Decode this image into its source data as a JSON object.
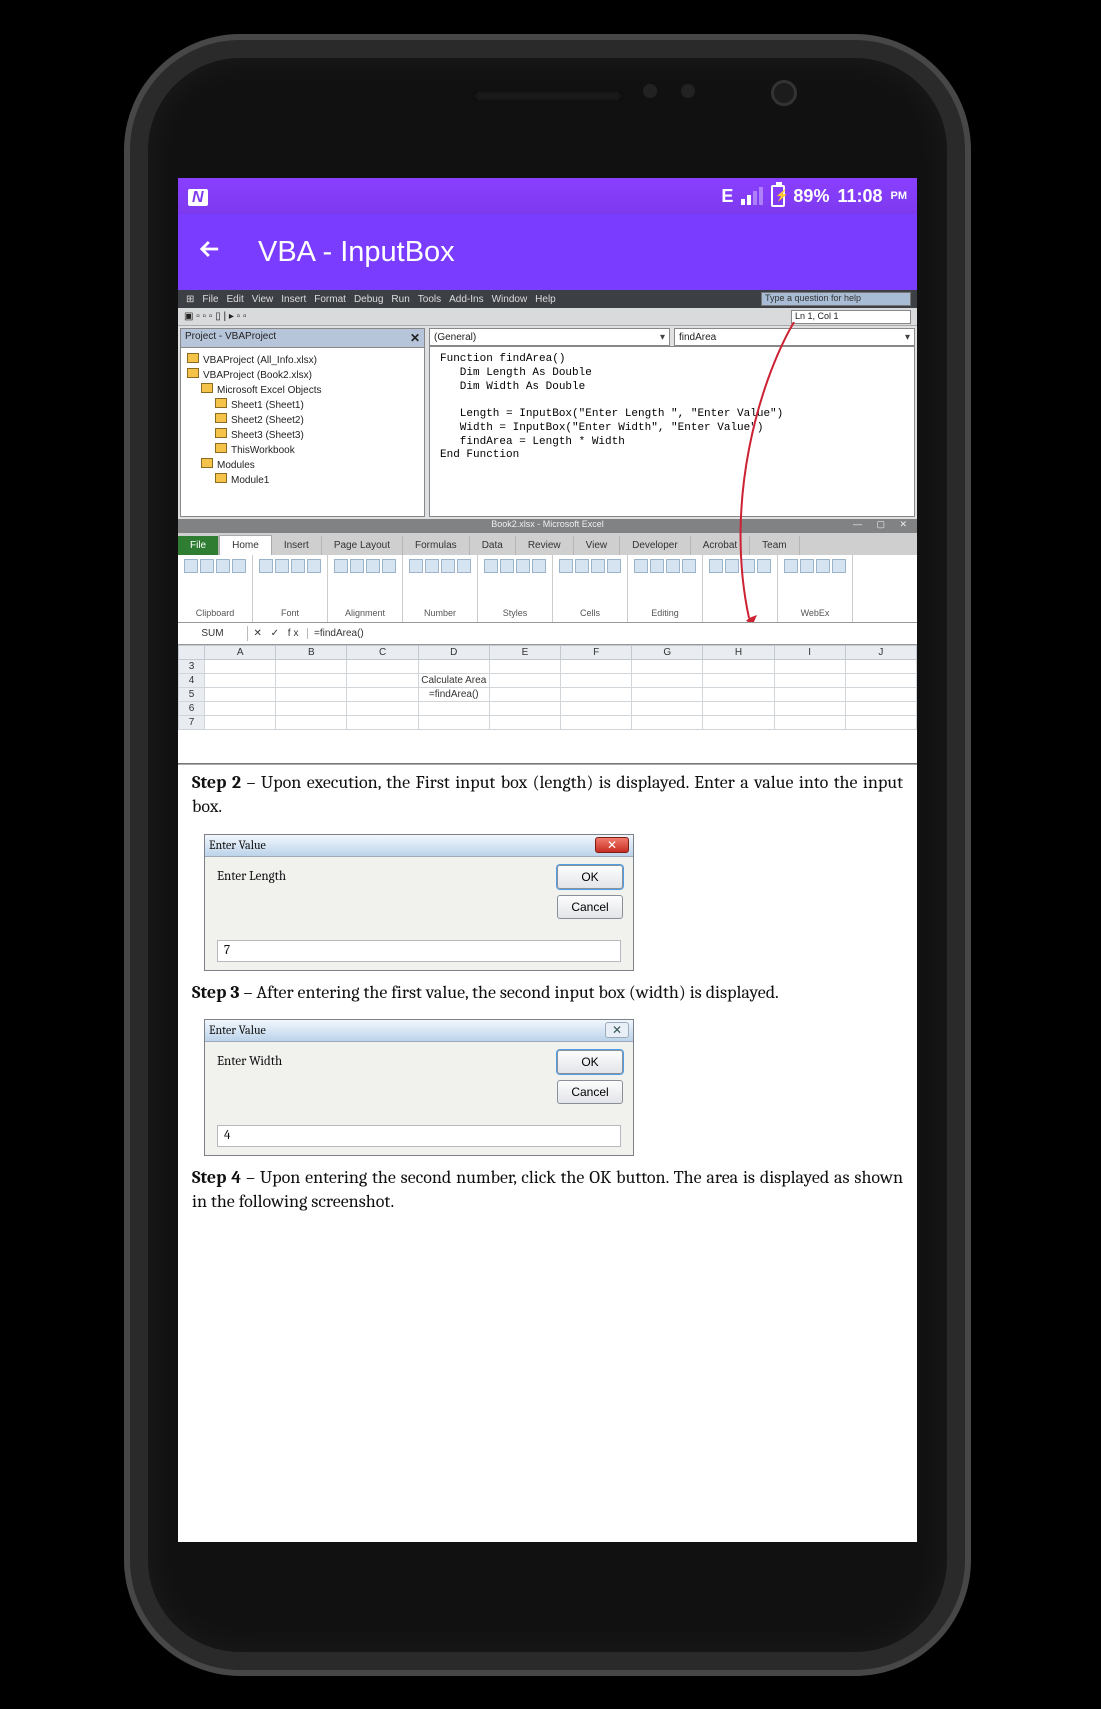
{
  "status_bar": {
    "n_icon": "N",
    "net_label": "E",
    "battery_pct": "89%",
    "time": "11:08",
    "time_suffix": "PM"
  },
  "app_bar": {
    "title": "VBA - InputBox"
  },
  "vba_editor": {
    "menus": [
      "File",
      "Edit",
      "View",
      "Insert",
      "Format",
      "Debug",
      "Run",
      "Tools",
      "Add-Ins",
      "Window",
      "Help"
    ],
    "help_placeholder": "Type a question for help",
    "line_col": "Ln 1, Col 1",
    "project_title": "Project - VBAProject",
    "project_tree": [
      {
        "label": "VBAProject (All_Info.xlsx)",
        "indent": 0
      },
      {
        "label": "VBAProject (Book2.xlsx)",
        "indent": 0
      },
      {
        "label": "Microsoft Excel Objects",
        "indent": 14
      },
      {
        "label": "Sheet1 (Sheet1)",
        "indent": 28
      },
      {
        "label": "Sheet2 (Sheet2)",
        "indent": 28
      },
      {
        "label": "Sheet3 (Sheet3)",
        "indent": 28
      },
      {
        "label": "ThisWorkbook",
        "indent": 28
      },
      {
        "label": "Modules",
        "indent": 14
      },
      {
        "label": "Module1",
        "indent": 28
      }
    ],
    "code_left_dropdown": "(General)",
    "code_right_dropdown": "findArea",
    "code_lines": [
      "Function findArea()",
      "   Dim Length As Double",
      "   Dim Width As Double",
      "",
      "   Length = InputBox(\"Enter Length \", \"Enter Value\")",
      "   Width = InputBox(\"Enter Width\", \"Enter Value\")",
      "   findArea = Length * Width",
      "End Function"
    ]
  },
  "excel": {
    "title": "Book2.xlsx - Microsoft Excel",
    "tabs": [
      "File",
      "Home",
      "Insert",
      "Page Layout",
      "Formulas",
      "Data",
      "Review",
      "View",
      "Developer",
      "Acrobat",
      "Team"
    ],
    "ribbon_groups": [
      "Clipboard",
      "Font",
      "Alignment",
      "Number",
      "Styles",
      "Cells",
      "Editing",
      "",
      "WebEx"
    ],
    "cellname": "SUM",
    "fx_icons": "✕ ✓ fx",
    "formula": "=findArea()",
    "headers": [
      "A",
      "B",
      "C",
      "D",
      "E",
      "F",
      "G",
      "H",
      "I",
      "J"
    ],
    "rows": [
      [
        "",
        "",
        "",
        "",
        "",
        "",
        "",
        "",
        "",
        ""
      ],
      [
        "",
        "",
        "",
        "Calculate Area",
        "",
        "",
        "",
        "",
        "",
        ""
      ],
      [
        "",
        "",
        "",
        "=findArea()",
        "",
        "",
        "",
        "",
        "",
        ""
      ],
      [
        "",
        "",
        "",
        "",
        "",
        "",
        "",
        "",
        "",
        ""
      ],
      [
        "",
        "",
        "",
        "",
        "",
        "",
        "",
        "",
        "",
        ""
      ]
    ],
    "row_nums": [
      "3",
      "4",
      "5",
      "6",
      "7"
    ]
  },
  "tutorial": {
    "step2_label": "Step 2",
    "step2_text": " – Upon execution, the First input box (length) is displayed. Enter a value into the input box.",
    "step3_label": "Step 3",
    "step3_text": " – After entering the first value, the second input box (width) is displayed.",
    "step4_label": "Step 4",
    "step4_text": " – Upon entering the second number, click the OK button. The area is displayed as shown in the following screenshot."
  },
  "dialog1": {
    "title": "Enter Value",
    "prompt": "Enter Length",
    "ok": "OK",
    "cancel": "Cancel",
    "input_value": "7"
  },
  "dialog2": {
    "title": "Enter Value",
    "prompt": "Enter Width",
    "ok": "OK",
    "cancel": "Cancel",
    "input_value": "4"
  }
}
